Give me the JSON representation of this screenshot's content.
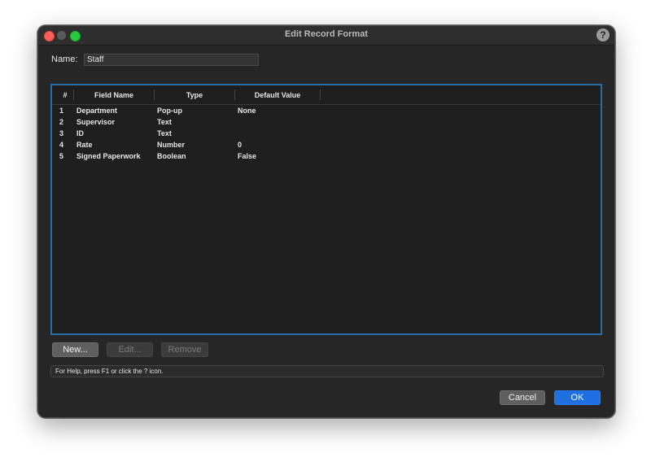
{
  "window": {
    "title": "Edit Record Format",
    "help_icon": "question-mark-icon",
    "help_glyph": "?"
  },
  "name_field": {
    "label": "Name:",
    "value": "Staff"
  },
  "table": {
    "columns": [
      "#",
      "Field Name",
      "Type",
      "Default Value"
    ],
    "rows": [
      {
        "num": "1",
        "field": "Department",
        "type": "Pop-up",
        "default": "None"
      },
      {
        "num": "2",
        "field": "Supervisor",
        "type": "Text",
        "default": ""
      },
      {
        "num": "3",
        "field": "ID",
        "type": "Text",
        "default": ""
      },
      {
        "num": "4",
        "field": "Rate",
        "type": "Number",
        "default": "0"
      },
      {
        "num": "5",
        "field": "Signed Paperwork",
        "type": "Boolean",
        "default": "False"
      }
    ]
  },
  "buttons": {
    "new": "New...",
    "edit": "Edit...",
    "remove": "Remove",
    "cancel": "Cancel",
    "ok": "OK"
  },
  "status": {
    "help_text": "For Help, press F1 or click the ? icon."
  },
  "colors": {
    "accent": "#1f6fe0",
    "table_border": "#2a6ea6",
    "close": "#ff5f57",
    "maximize": "#28c840"
  }
}
